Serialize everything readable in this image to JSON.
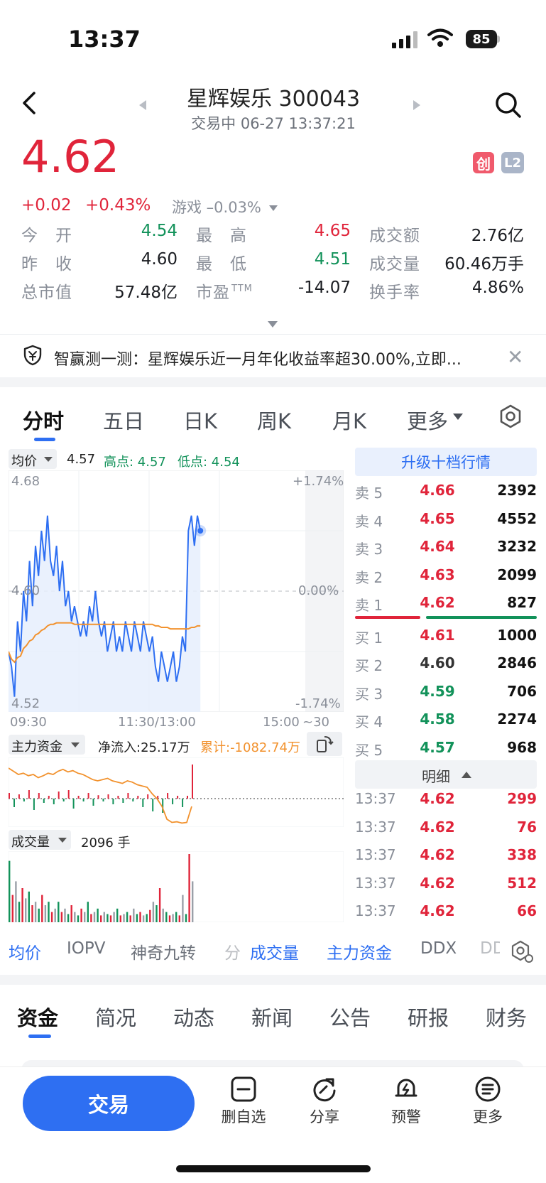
{
  "status_bar": {
    "time": "13:37",
    "battery": "85"
  },
  "header": {
    "title": "星辉娱乐 300043",
    "trade_status": "交易中 06-27 13:37:21"
  },
  "quote": {
    "price": "4.62",
    "change": "+0.02",
    "change_pct": "+0.43%",
    "sector": "游戏 –0.03%",
    "badge_chuang": "创",
    "badge_l2": "L2",
    "stats": [
      {
        "label": "今　开",
        "value": "4.54",
        "color": "#12925a"
      },
      {
        "label": "最　高",
        "value": "4.65",
        "color": "#e0243a"
      },
      {
        "label": "成交额",
        "value": "2.76亿",
        "color": "#1b1d22"
      },
      {
        "label": "昨　收",
        "value": "4.60",
        "color": "#1b1d22"
      },
      {
        "label": "最　低",
        "value": "4.51",
        "color": "#12925a"
      },
      {
        "label": "成交量",
        "value": "60.46万手",
        "color": "#1b1d22"
      },
      {
        "label": "总市值",
        "value": "57.48亿",
        "color": "#1b1d22"
      },
      {
        "label": "市盈",
        "value": "-14.07",
        "color": "#1b1d22"
      },
      {
        "label": "换手率",
        "value": "4.86%",
        "color": "#1b1d22"
      }
    ],
    "pe_superscript": "TTM"
  },
  "banner": {
    "text": "智赢测一测：星辉娱乐近一月年化收益率超30.00%,立即..."
  },
  "period_tabs": [
    "分时",
    "五日",
    "日K",
    "周K",
    "月K",
    "更多"
  ],
  "chart_header": {
    "avg_label": "均价",
    "avg_value": "4.57",
    "high": "高点: 4.57",
    "low": "低点: 4.54"
  },
  "chart_data": {
    "type": "line",
    "y_axis": {
      "top": "4.68",
      "mid": "4.60",
      "bottom": "4.52"
    },
    "pct_axis": {
      "top": "+1.74%",
      "mid": "0.00%",
      "bottom": "-1.74%"
    },
    "x_ticks": [
      "09:30",
      "11:30/13:00",
      "15:00",
      "~30"
    ],
    "ylim": [
      4.52,
      4.68
    ],
    "prev_close": 4.6,
    "series": [
      {
        "color": "#2e6ff2",
        "values": [
          4.56,
          4.55,
          4.53,
          4.58,
          4.56,
          4.6,
          4.58,
          4.62,
          4.59,
          4.63,
          4.61,
          4.64,
          4.62,
          4.65,
          4.62,
          4.61,
          4.63,
          4.6,
          4.62,
          4.59,
          4.6,
          4.58,
          4.59,
          4.58,
          4.57,
          4.58,
          4.57,
          4.59,
          4.58,
          4.6,
          4.58,
          4.57,
          4.58,
          4.56,
          4.57,
          4.58,
          4.56,
          4.57,
          4.56,
          4.58,
          4.57,
          4.56,
          4.58,
          4.57,
          4.56,
          4.58,
          4.57,
          4.56,
          4.57,
          4.55,
          4.54,
          4.56,
          4.55,
          4.54,
          4.55,
          4.56,
          4.54,
          4.55,
          4.57,
          4.56,
          4.64,
          4.65,
          4.63,
          4.65,
          4.64
        ]
      },
      {
        "color": "#f2922e",
        "values": [
          4.56,
          4.555,
          4.553,
          4.556,
          4.557,
          4.562,
          4.564,
          4.567,
          4.568,
          4.571,
          4.572,
          4.574,
          4.575,
          4.577,
          4.578,
          4.578,
          4.579,
          4.579,
          4.579,
          4.579,
          4.579,
          4.579,
          4.578,
          4.578,
          4.578,
          4.578,
          4.578,
          4.578,
          4.578,
          4.578,
          4.578,
          4.578,
          4.578,
          4.578,
          4.578,
          4.578,
          4.578,
          4.578,
          4.578,
          4.578,
          4.578,
          4.578,
          4.578,
          4.578,
          4.578,
          4.578,
          4.578,
          4.578,
          4.578,
          4.577,
          4.577,
          4.576,
          4.576,
          4.576,
          4.575,
          4.575,
          4.575,
          4.575,
          4.575,
          4.575,
          4.575,
          4.576,
          4.576,
          4.577,
          4.577
        ]
      }
    ]
  },
  "capital_header": {
    "label": "主力资金",
    "net_inflow": "净流入:25.17万",
    "cumulative": "累计:-1082.74万"
  },
  "capital_data": {
    "line": [
      0.9,
      0.85,
      0.8,
      0.82,
      0.78,
      0.8,
      0.75,
      0.78,
      0.82,
      0.8,
      0.85,
      0.88,
      0.84,
      0.86,
      0.82,
      0.8,
      0.76,
      0.72,
      0.7,
      0.72,
      0.74,
      0.7,
      0.68,
      0.66,
      0.7,
      0.68,
      0.64,
      0.62,
      0.6,
      0.5,
      0.42,
      0.3,
      0.1,
      0.05,
      0.06,
      0.04,
      0.05,
      0.3
    ],
    "bars": [
      0.2,
      -0.3,
      0.15,
      -0.1,
      0.3,
      -0.4,
      0.2,
      -0.15,
      0.1,
      -0.2,
      0.25,
      -0.1,
      0.3,
      -0.35,
      0.1,
      -0.1,
      0.2,
      -0.25,
      0.12,
      -0.1,
      0.15,
      -0.2,
      0.1,
      -0.15,
      0.2,
      -0.1,
      0.1,
      -0.3,
      0.15,
      -0.45,
      0.1,
      -0.5,
      0.2,
      -0.2,
      0.1,
      -0.3,
      0.1,
      1.2
    ]
  },
  "volume_header": {
    "label": "成交量",
    "value": "2096 手"
  },
  "volume_data": [
    0.9,
    0.4,
    0.6,
    0.3,
    0.5,
    0.35,
    0.45,
    0.25,
    0.3,
    0.2,
    0.4,
    0.25,
    0.3,
    0.15,
    0.2,
    0.3,
    0.15,
    0.2,
    0.12,
    0.25,
    0.15,
    0.1,
    0.2,
    0.15,
    0.3,
    0.12,
    0.15,
    0.2,
    0.1,
    0.15,
    0.12,
    0.1,
    0.15,
    0.2,
    0.1,
    0.12,
    0.15,
    0.1,
    0.2,
    0.12,
    0.15,
    0.1,
    0.12,
    0.18,
    0.3,
    0.25,
    0.5,
    0.2,
    0.15,
    0.1,
    0.12,
    0.15,
    0.1,
    0.4,
    0.12,
    1.0,
    0.6
  ],
  "order_book": {
    "upgrade": "升级十档行情",
    "asks": [
      {
        "label": "卖 5",
        "price": "4.66",
        "vol": "2392",
        "color": "#e0243a"
      },
      {
        "label": "卖 4",
        "price": "4.65",
        "vol": "4552",
        "color": "#e0243a"
      },
      {
        "label": "卖 3",
        "price": "4.64",
        "vol": "3232",
        "color": "#e0243a"
      },
      {
        "label": "卖 2",
        "price": "4.63",
        "vol": "2099",
        "color": "#e0243a"
      },
      {
        "label": "卖 1",
        "price": "4.62",
        "vol": "827",
        "color": "#e0243a"
      }
    ],
    "bids": [
      {
        "label": "买 1",
        "price": "4.61",
        "vol": "1000",
        "color": "#e0243a"
      },
      {
        "label": "买 2",
        "price": "4.60",
        "vol": "2846",
        "color": "#333333"
      },
      {
        "label": "买 3",
        "price": "4.59",
        "vol": "706",
        "color": "#12925a"
      },
      {
        "label": "买 4",
        "price": "4.58",
        "vol": "2274",
        "color": "#12925a"
      },
      {
        "label": "买 5",
        "price": "4.57",
        "vol": "968",
        "color": "#12925a"
      }
    ],
    "detail_label": "明细",
    "ticks": [
      {
        "time": "13:37",
        "price": "4.62",
        "vol": "299"
      },
      {
        "time": "13:37",
        "price": "4.62",
        "vol": "76"
      },
      {
        "time": "13:37",
        "price": "4.62",
        "vol": "338"
      },
      {
        "time": "13:37",
        "price": "4.62",
        "vol": "512"
      },
      {
        "time": "13:37",
        "price": "4.62",
        "vol": "66"
      }
    ]
  },
  "indicator_tabs": [
    "均价",
    "IOPV",
    "神奇九转",
    "分",
    "成交量",
    "主力资金",
    "DDX",
    "DD"
  ],
  "section_tabs": [
    "资金",
    "简况",
    "动态",
    "新闻",
    "公告",
    "研报",
    "财务"
  ],
  "bottom_bar": {
    "trade": "交易",
    "items": [
      "删自选",
      "分享",
      "预警",
      "更多"
    ]
  }
}
